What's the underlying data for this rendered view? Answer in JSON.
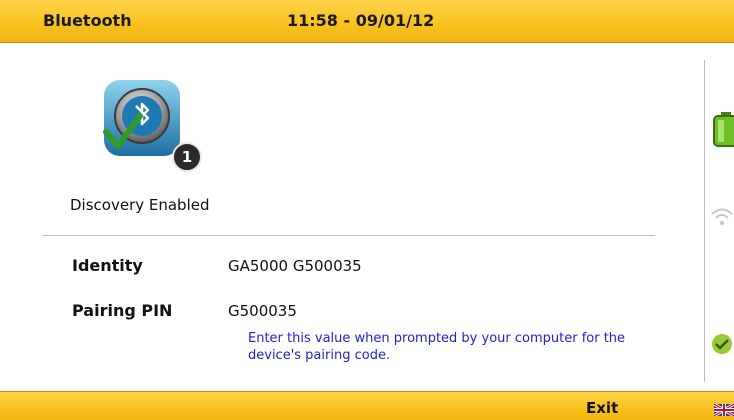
{
  "header": {
    "title": "Bluetooth",
    "clock": "11:58 - 09/01/12"
  },
  "bluetooth": {
    "status": "Discovery Enabled",
    "badge_count": "1",
    "rows": [
      {
        "label": "Identity",
        "value": "GA5000 G500035"
      },
      {
        "label": "Pairing PIN",
        "value": "G500035"
      }
    ],
    "hint": "Enter this value when prompted by your computer for the device's pairing code."
  },
  "side_icons": [
    "battery-icon",
    "wifi-icon",
    "check-status-icon"
  ],
  "footer": {
    "exit_label": "Exit",
    "language_icon": "uk-flag-icon"
  }
}
